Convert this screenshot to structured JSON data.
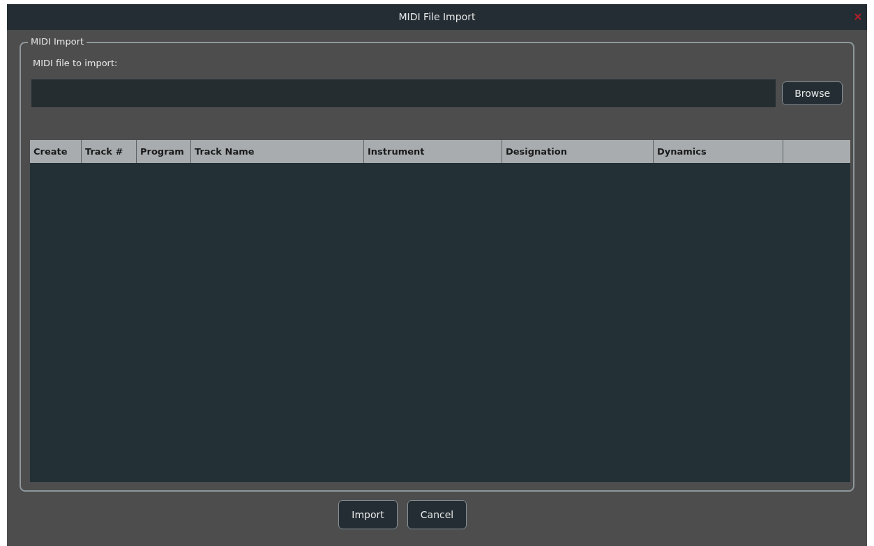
{
  "window": {
    "title": "MIDI File Import"
  },
  "group": {
    "legend": "MIDI Import",
    "file_label": "MIDI file to import:",
    "browse_button": "Browse"
  },
  "table": {
    "columns": [
      "Create",
      "Track #",
      "Program",
      "Track Name",
      "Instrument",
      "Designation",
      "Dynamics"
    ]
  },
  "buttons": [
    "Import",
    "Cancel"
  ]
}
